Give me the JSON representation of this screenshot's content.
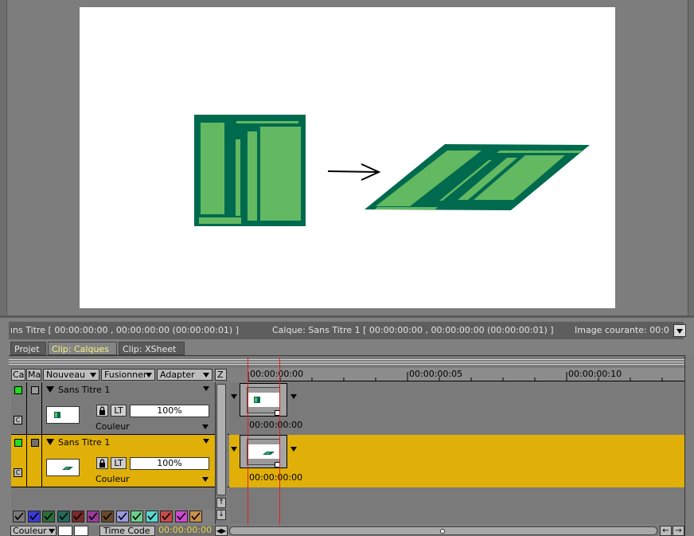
{
  "info_bar": {
    "left_text": "ıns Titre [ 00:00:00:00 , 00:00:00:00  (00:00:00:01) ]",
    "middle_text": "Calque: Sans Titre 1 [ 00:00:00:00 , 00:00:00:00  (00:00:00:01) ]",
    "right_text": "Image courante: 00:0"
  },
  "tabs": [
    {
      "label": "Projet"
    },
    {
      "label": "Clip: Calques"
    },
    {
      "label": "Clip: XSheet"
    }
  ],
  "header": {
    "col_ca": "Ca",
    "col_ma": "Ma",
    "nouveau": "Nouveau",
    "fusionner": "Fusionner",
    "adapter": "Adapter",
    "z": "Z"
  },
  "ruler": {
    "ticks": [
      "00:00:00:00",
      "00:00:00:05",
      "00:00:00:10"
    ]
  },
  "layers": [
    {
      "name": "Sans Titre 1",
      "lock_mode": "LT",
      "opacity": "100%",
      "blend": "Couleur",
      "clip_timecode": "00:00:00:00",
      "badge": "C",
      "selected": false
    },
    {
      "name": "Sans Titre 1",
      "lock_mode": "LT",
      "opacity": "100%",
      "blend": "Couleur",
      "clip_timecode": "00:00:00:00",
      "badge": "C",
      "selected": true
    }
  ],
  "color_swatches": [
    "#7a7a7a",
    "#3a3ad8",
    "#2a6e3a",
    "#246a5a",
    "#7a2a2a",
    "#9a3a9a",
    "#6a4a2a",
    "#9a9ae0",
    "#6ad08a",
    "#5ad8d0",
    "#c84a4a",
    "#d04ad0",
    "#c8904a"
  ],
  "bottom_bar": {
    "couleur": "Couleur",
    "time_code_label": "Time Code",
    "time_code_value": "00:00:00:00"
  },
  "colors": {
    "selected_row": "#e0b008",
    "tab_active_text": "#f4f280",
    "artwork_dark": "#006a4e",
    "artwork_light": "#63b862"
  }
}
